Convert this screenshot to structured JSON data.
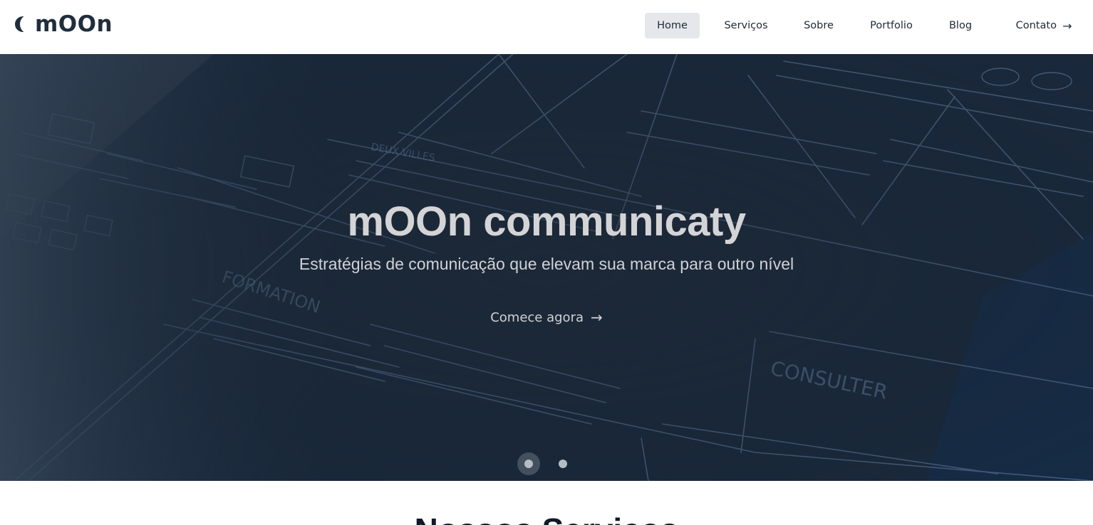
{
  "header": {
    "logo_text": "mOOn",
    "logo_icon": "crescent-moon-icon",
    "nav": [
      {
        "label": "Home",
        "active": true
      },
      {
        "label": "Serviços",
        "active": false
      },
      {
        "label": "Sobre",
        "active": false
      },
      {
        "label": "Portfolio",
        "active": false
      },
      {
        "label": "Blog",
        "active": false
      }
    ],
    "contact_label": "Contato",
    "contact_icon": "arrow-right-icon"
  },
  "hero": {
    "title": "mOOn communicaty",
    "subtitle": "Estratégias de comunicação que elevam sua marca para outro nível",
    "cta_label": "Comece agora",
    "cta_icon": "arrow-right-icon",
    "slides_total": 2,
    "active_slide": 1,
    "sketch_words": [
      "DEUX VILLES",
      "FORMATION",
      "CONSULTER"
    ]
  },
  "section": {
    "title": "Nossos Serviços"
  },
  "colors": {
    "brand_dark": "#1f2d3d",
    "hero_bg": "#1c2b3d",
    "nav_active_bg": "#e5e7eb"
  }
}
